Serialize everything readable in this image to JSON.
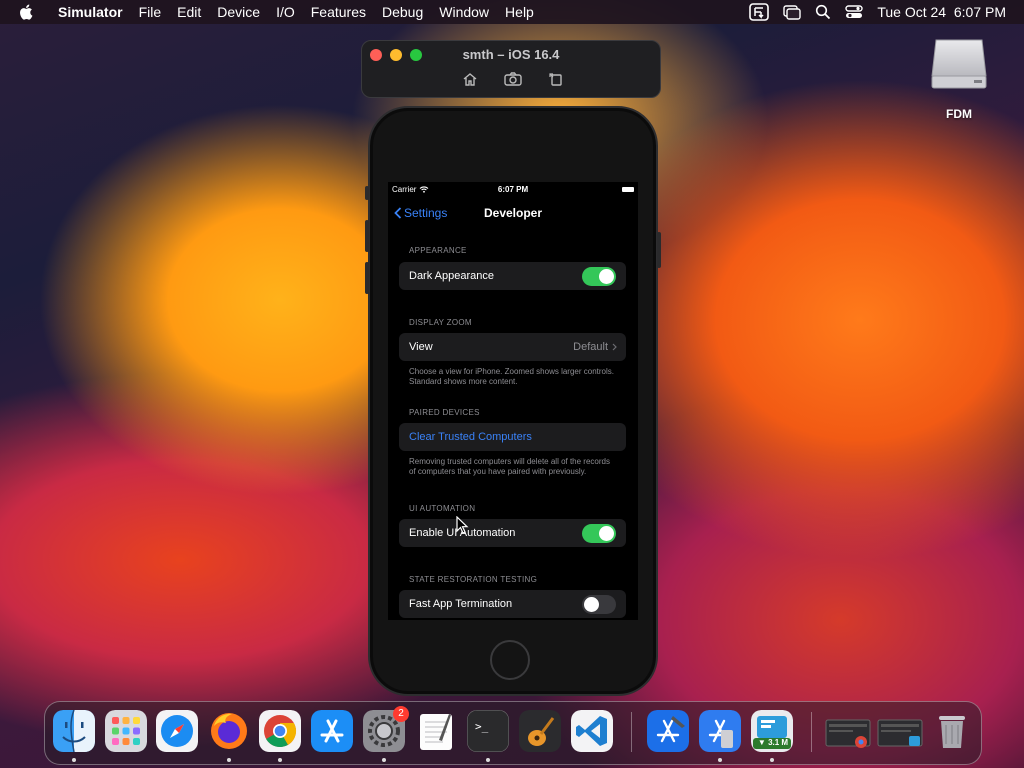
{
  "menubar": {
    "app_name": "Simulator",
    "items": [
      "File",
      "Edit",
      "Device",
      "I/O",
      "Features",
      "Debug",
      "Window",
      "Help"
    ],
    "datetime": "Tue Oct 24  6:07 PM"
  },
  "desktop": {
    "drive_label": "FDM"
  },
  "simulator": {
    "title": "smth – iOS 16.4"
  },
  "statusbar": {
    "carrier": "Carrier",
    "time": "6:07 PM"
  },
  "navbar": {
    "back_label": "Settings",
    "title": "Developer"
  },
  "sections": {
    "appearance": {
      "header": "APPEARANCE",
      "dark_label": "Dark Appearance",
      "dark_on": true
    },
    "zoom": {
      "header": "DISPLAY ZOOM",
      "view_label": "View",
      "view_value": "Default",
      "footer": "Choose a view for iPhone. Zoomed shows larger controls. Standard shows more content."
    },
    "paired": {
      "header": "PAIRED DEVICES",
      "clear_label": "Clear Trusted Computers",
      "footer": "Removing trusted computers will delete all of the records of computers that you have paired with previously."
    },
    "automation": {
      "header": "UI AUTOMATION",
      "enable_label": "Enable UI Automation",
      "enable_on": true
    },
    "restoration": {
      "header": "STATE RESTORATION TESTING",
      "fast_label": "Fast App Termination",
      "fast_on": false
    }
  },
  "dock": {
    "settings_badge": "2",
    "download_speed": "▼ 3.1 M"
  },
  "colors": {
    "accent_blue": "#3a82f7",
    "toggle_on": "#34c759"
  }
}
